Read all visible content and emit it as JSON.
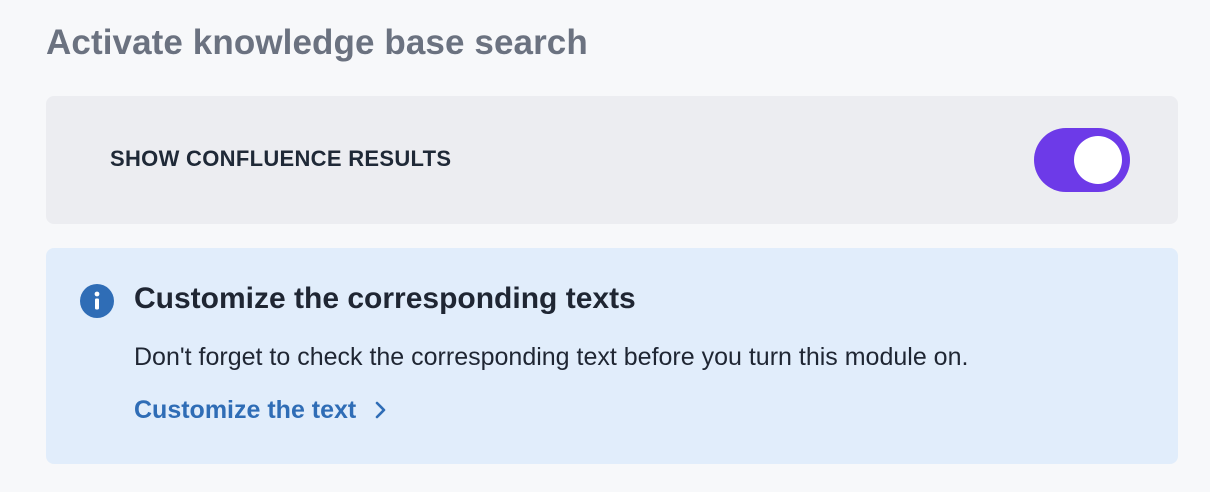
{
  "page": {
    "title": "Activate knowledge base search"
  },
  "toggle_card": {
    "label": "SHOW CONFLUENCE RESULTS",
    "toggle_state": "on",
    "toggle_color": "#6d3ae8"
  },
  "info_card": {
    "icon": "info-icon",
    "title": "Customize the corresponding texts",
    "body": "Don't forget to check the corresponding text before you turn this module on.",
    "link_label": "Customize the text",
    "link_icon": "chevron-right-icon",
    "accent_color": "#2f6db6"
  }
}
